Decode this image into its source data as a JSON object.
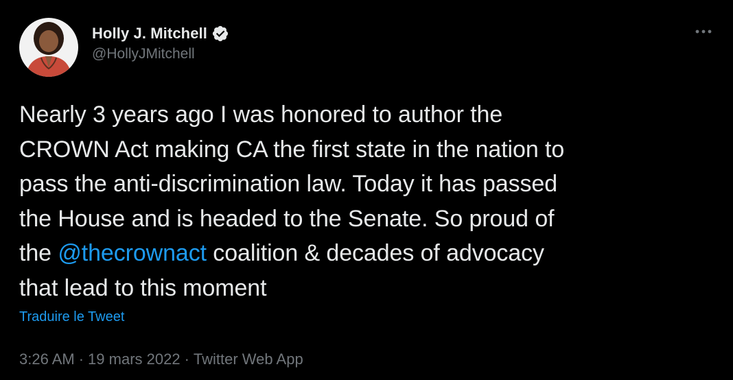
{
  "author": {
    "display_name": "Holly J. Mitchell",
    "handle": "@HollyJMitchell",
    "verified": true
  },
  "tweet": {
    "text_lines": [
      "Nearly 3 years ago I was honored to author the",
      "CROWN Act making CA the first state in the nation to",
      "pass the anti-discrimination law. Today it has passed",
      "the House and is headed to the Senate. So proud of"
    ],
    "line5_prefix": "the ",
    "mention": "@thecrownact",
    "line5_suffix": " coalition & decades of advocacy",
    "last_line": "that lead to this moment"
  },
  "translate_label": "Traduire le Tweet",
  "meta": {
    "time": "3:26 AM",
    "separator": "·",
    "date": "19 mars 2022",
    "source": "Twitter Web App"
  },
  "icons": {
    "verified": "verified-badge-icon",
    "more": "more-options-icon"
  },
  "colors": {
    "background": "#000000",
    "text": "#e7e9ea",
    "secondary": "#71767b",
    "accent": "#1d9bf0"
  }
}
